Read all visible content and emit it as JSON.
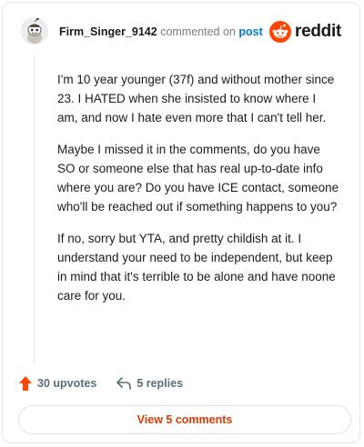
{
  "comment": {
    "username": "Firm_Singer_9142",
    "action_text": "commented on",
    "target_link": "post",
    "paragraphs": [
      "I'm 10 year younger (37f) and without mother since 23. I HATED when she insisted to know where I am, and now I hate even more that I can't tell her.",
      "Maybe I missed it in the comments, do you have SO or someone else that has real up-to-date info where you are? Do you have ICE contact, someone who'll be reached out if something happens to you?",
      "If no, sorry but YTA, and pretty childish at it. I understand your need to be independent, but keep in mind that it's terrible to be alone and have noone care for you."
    ],
    "upvotes_label": "30 upvotes",
    "replies_label": "5 replies",
    "view_button_label": "View 5 comments"
  },
  "brand": {
    "wordmark": "reddit",
    "accent_color": "#ff4500",
    "link_color": "#0079d3",
    "button_text_color": "#d93a00"
  },
  "icons": {
    "avatar": "snoo-avatar-icon",
    "logo": "reddit-logo-icon",
    "upvote": "upvote-arrow-icon",
    "reply": "reply-arrow-icon"
  }
}
